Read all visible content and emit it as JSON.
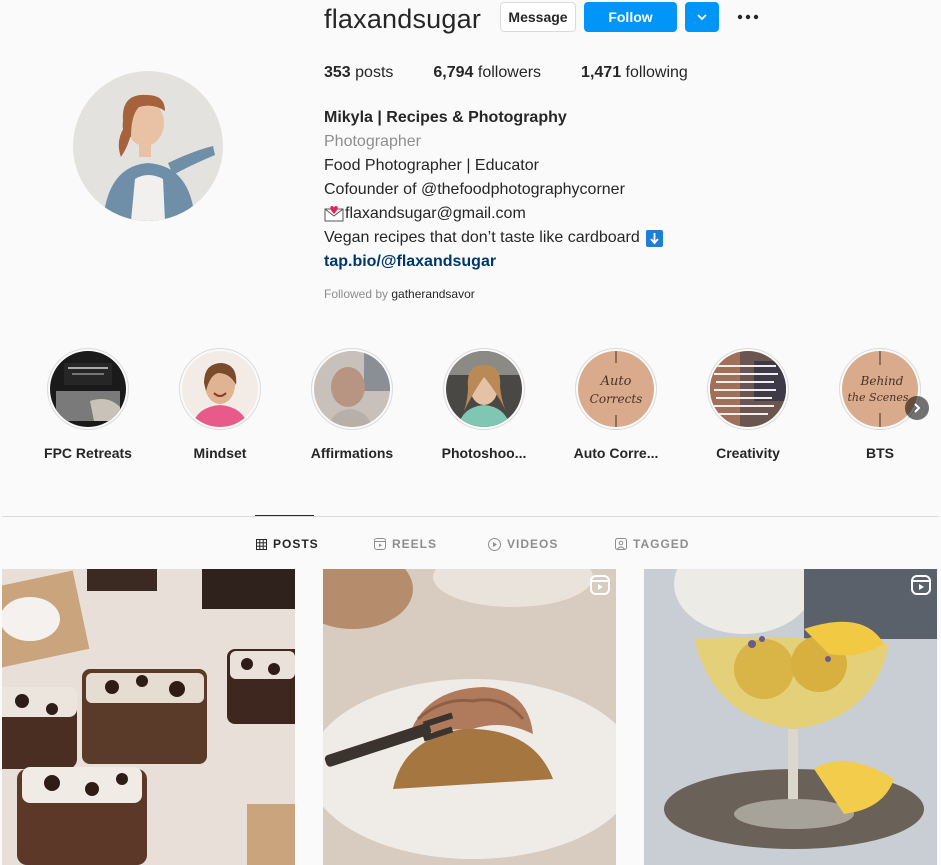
{
  "profile": {
    "username": "flaxandsugar",
    "message_label": "Message",
    "follow_label": "Follow",
    "stats": {
      "posts_count": "353",
      "posts_label": "posts",
      "followers_count": "6,794",
      "followers_label": "followers",
      "following_count": "1,471",
      "following_label": "following"
    },
    "bio": {
      "name": "Mikyla | Recipes & Photography",
      "category": "Photographer",
      "line1": "Food Photographer | Educator",
      "line2": "Cofounder of @thefoodphotographycorner",
      "email": "flaxandsugar@gmail.com",
      "line4": "Vegan recipes that don’t taste like cardboard",
      "link": "tap.bio/@flaxandsugar"
    },
    "followed_by_label": "Followed by",
    "followed_by_user": "gatherandsavor"
  },
  "highlights": [
    {
      "label": "FPC Retreats"
    },
    {
      "label": "Mindset"
    },
    {
      "label": "Affirmations"
    },
    {
      "label": "Photoshoo..."
    },
    {
      "label": "Auto Corre..."
    },
    {
      "label": "Creativity"
    },
    {
      "label": "BTS"
    }
  ],
  "tabs": [
    {
      "label": "POSTS",
      "icon": "grid-icon"
    },
    {
      "label": "REELS",
      "icon": "reels-icon"
    },
    {
      "label": "VIDEOS",
      "icon": "play-icon"
    },
    {
      "label": "TAGGED",
      "icon": "tagged-icon"
    }
  ],
  "colors": {
    "accent": "#0095f6",
    "link": "#00376b",
    "muted": "#8e8e8e"
  }
}
